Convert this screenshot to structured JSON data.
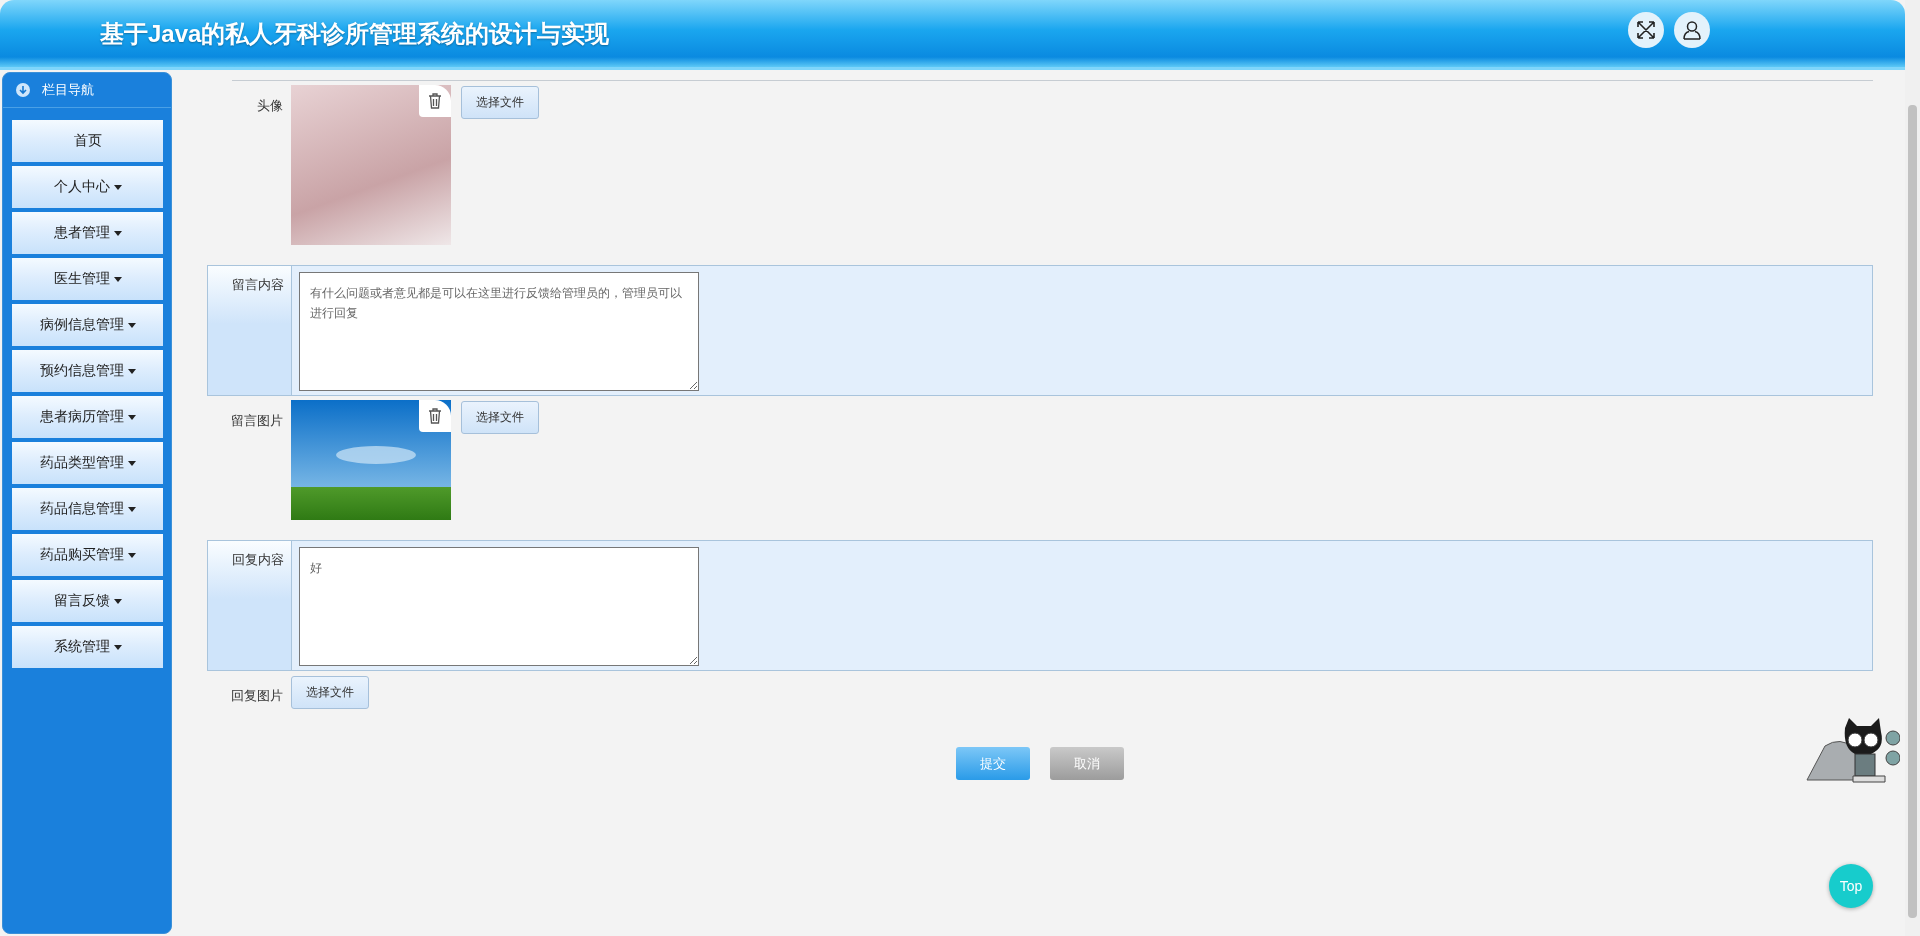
{
  "header": {
    "title": "基于Java的私人牙科诊所管理系统的设计与实现",
    "actions": [
      {
        "kind": "fullscreen"
      },
      {
        "kind": "user"
      }
    ]
  },
  "sidebar": {
    "title": "栏目导航",
    "items": [
      {
        "label": "首页",
        "has_menu": false
      },
      {
        "label": "个人中心",
        "has_menu": true
      },
      {
        "label": "患者管理",
        "has_menu": true
      },
      {
        "label": "医生管理",
        "has_menu": true
      },
      {
        "label": "病例信息管理",
        "has_menu": true
      },
      {
        "label": "预约信息管理",
        "has_menu": true
      },
      {
        "label": "患者病历管理",
        "has_menu": true
      },
      {
        "label": "药品类型管理",
        "has_menu": true
      },
      {
        "label": "药品信息管理",
        "has_menu": true
      },
      {
        "label": "药品购买管理",
        "has_menu": true
      },
      {
        "label": "留言反馈",
        "has_menu": true
      },
      {
        "label": "系统管理",
        "has_menu": true
      }
    ]
  },
  "form": {
    "fields": [
      {
        "kind": "image",
        "label": "头像",
        "picture": {
          "kind": "portrait"
        },
        "button": "选择文件"
      },
      {
        "kind": "textarea",
        "label": "留言内容",
        "value": "有什么问题或者意见都是可以在这里进行反馈给管理员的，管理员可以进行回复"
      },
      {
        "kind": "image",
        "label": "留言图片",
        "picture": {
          "kind": "landscape"
        },
        "button": "选择文件"
      },
      {
        "kind": "textarea",
        "label": "回复内容",
        "value": "好"
      },
      {
        "kind": "file",
        "label": "回复图片",
        "button": "选择文件"
      }
    ],
    "actions": [
      {
        "label": "提交",
        "kind": "primary"
      },
      {
        "label": "取消",
        "kind": "secondary"
      }
    ]
  },
  "back_to_top": "Top"
}
